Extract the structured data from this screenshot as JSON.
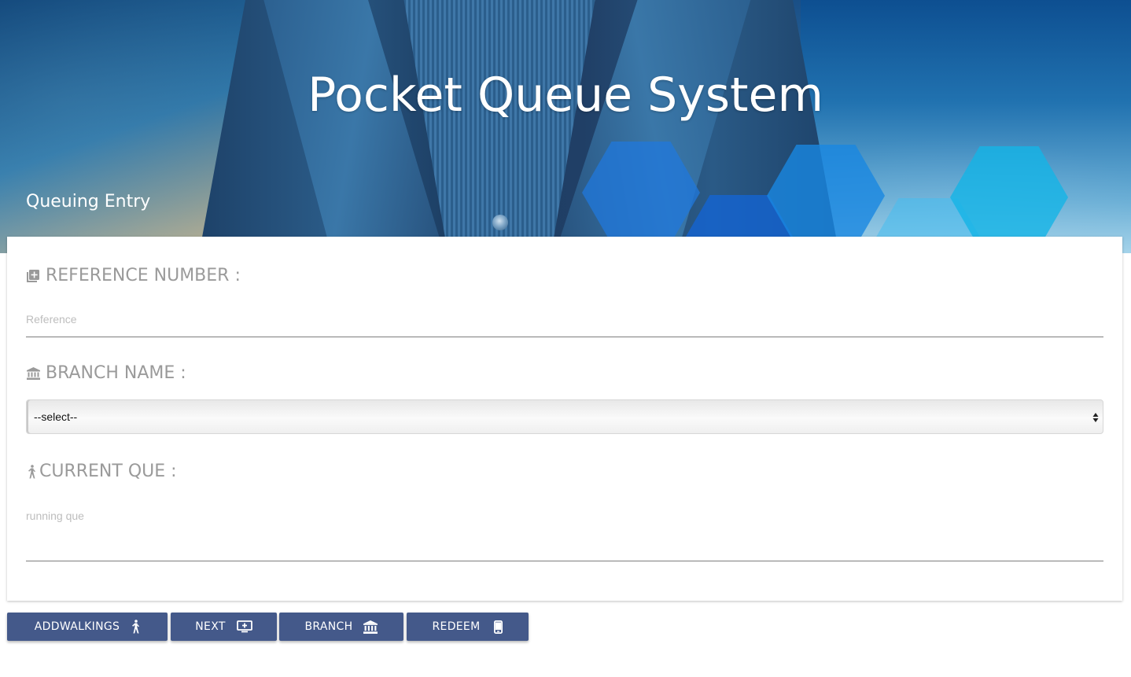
{
  "header": {
    "title": "Pocket Queue System",
    "subtitle": "Queuing Entry"
  },
  "form": {
    "reference": {
      "label": "REFERENCE NUMBER :",
      "placeholder": "Reference",
      "value": "",
      "icon": "add-to-queue-icon"
    },
    "branch": {
      "label": "BRANCH NAME :",
      "selected": "--select--",
      "icon": "bank-icon"
    },
    "current_que": {
      "label": "CURRENT QUE :",
      "placeholder": "running que",
      "value": "",
      "icon": "walking-person-icon"
    }
  },
  "buttons": {
    "add": {
      "label": "ADDWALKINGS",
      "icon": "walking-person-icon"
    },
    "next": {
      "label": "NEXT",
      "icon": "add-to-queue-icon"
    },
    "branch": {
      "label": "BRANCH",
      "icon": "bank-icon"
    },
    "redeem": {
      "label": "REDEEM",
      "icon": "phone-icon"
    }
  },
  "colors": {
    "button_bg": "#44598a",
    "label_text": "#9a9a9a",
    "placeholder_text": "#bdbdbd"
  }
}
